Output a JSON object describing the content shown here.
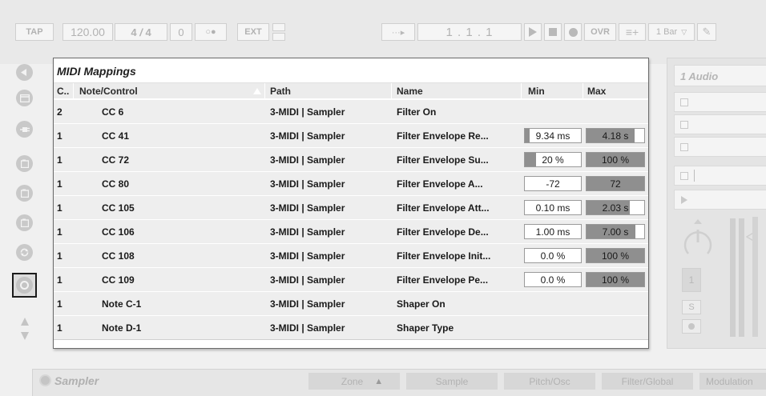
{
  "transport": {
    "tap_label": "TAP",
    "tempo": "120.00",
    "signature_num": "4",
    "signature_sep": "/",
    "signature_den": "4",
    "groove": "0",
    "metronome_symbol": "○●",
    "ext_label": "EXT",
    "position": "1 .   1 .   1",
    "ovr_label": "OVR",
    "quantization": "1 Bar"
  },
  "mappings": {
    "title": "MIDI Mappings",
    "columns": {
      "channel": "C..",
      "note_control": "Note/Control",
      "path": "Path",
      "name": "Name",
      "min": "Min",
      "max": "Max"
    },
    "rows": [
      {
        "channel": "2",
        "control": "CC 6",
        "path": "3-MIDI | Sampler",
        "name": "Filter On"
      },
      {
        "channel": "1",
        "control": "CC 41",
        "path": "3-MIDI | Sampler",
        "name": "Filter Envelope Re...",
        "min": "9.34 ms",
        "min_fill": 0.08,
        "max": "4.18 s",
        "max_fill": 0.84
      },
      {
        "channel": "1",
        "control": "CC 72",
        "path": "3-MIDI | Sampler",
        "name": "Filter Envelope Su...",
        "min": "20 %",
        "min_fill": 0.2,
        "max": "100 %",
        "max_fill": 1.0
      },
      {
        "channel": "1",
        "control": "CC 80",
        "path": "3-MIDI | Sampler",
        "name": "Filter Envelope A...",
        "min": "-72",
        "min_fill": 0.0,
        "max": "72",
        "max_fill": 1.0
      },
      {
        "channel": "1",
        "control": "CC 105",
        "path": "3-MIDI | Sampler",
        "name": "Filter Envelope Att...",
        "min": "0.10 ms",
        "min_fill": 0.0,
        "max": "2.03 s",
        "max_fill": 0.75
      },
      {
        "channel": "1",
        "control": "CC 106",
        "path": "3-MIDI | Sampler",
        "name": "Filter Envelope De...",
        "min": "1.00 ms",
        "min_fill": 0.0,
        "max": "7.00 s",
        "max_fill": 0.85
      },
      {
        "channel": "1",
        "control": "CC 108",
        "path": "3-MIDI | Sampler",
        "name": "Filter Envelope Init...",
        "min": "0.0 %",
        "min_fill": 0.0,
        "max": "100 %",
        "max_fill": 1.0
      },
      {
        "channel": "1",
        "control": "CC 109",
        "path": "3-MIDI | Sampler",
        "name": "Filter Envelope Pe...",
        "min": "0.0 %",
        "min_fill": 0.0,
        "max": "100 %",
        "max_fill": 1.0
      },
      {
        "channel": "1",
        "control": "Note C-1",
        "path": "3-MIDI | Sampler",
        "name": "Shaper On"
      },
      {
        "channel": "1",
        "control": "Note D-1",
        "path": "3-MIDI | Sampler",
        "name": "Shaper Type"
      }
    ]
  },
  "track": {
    "title": "1 Audio",
    "track_number": "1",
    "solo_label": "S"
  },
  "device": {
    "name": "Sampler",
    "tabs": [
      "Zone",
      "Sample",
      "Pitch/Osc",
      "Filter/Global",
      "Modulation"
    ]
  }
}
